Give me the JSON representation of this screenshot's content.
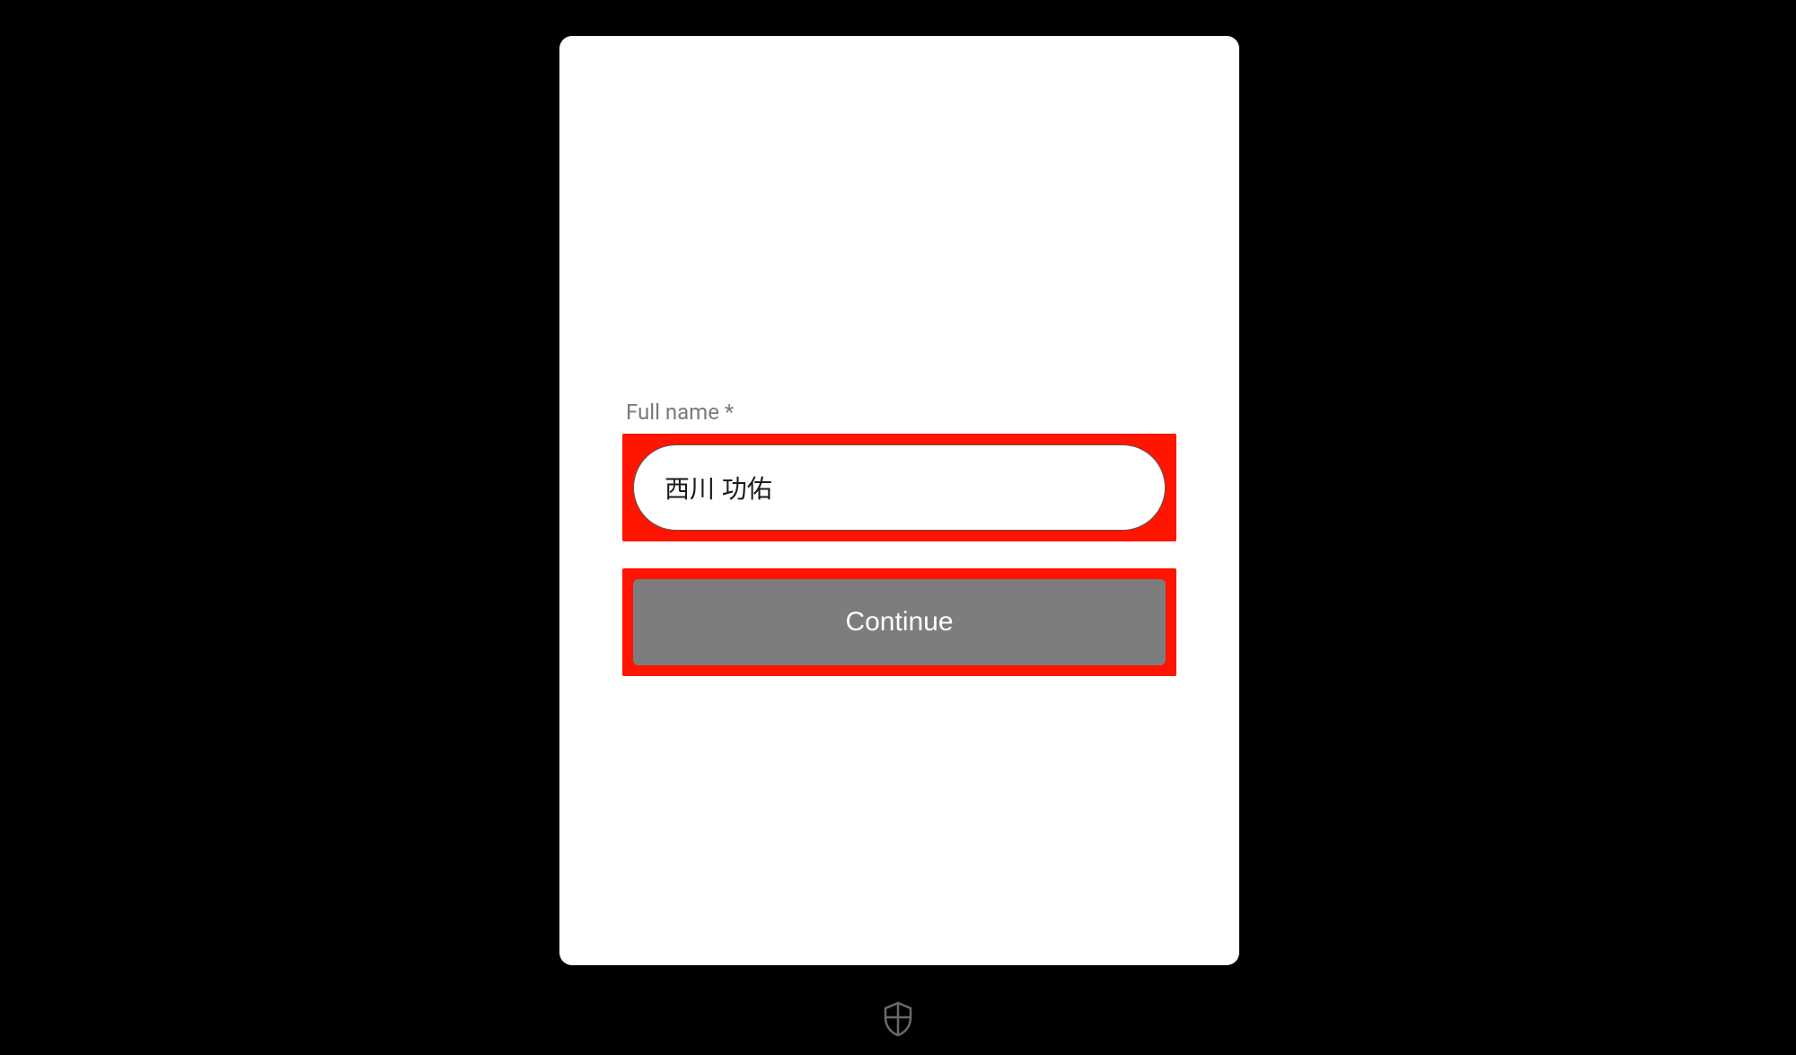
{
  "form": {
    "full_name_label": "Full name *",
    "full_name_value": "西川 功佑",
    "continue_label": "Continue"
  },
  "footer": {
    "icon_name": "shield-icon"
  },
  "colors": {
    "highlight": "#ff1500",
    "button_bg": "#7d7d7d",
    "label": "#7a7a7a"
  }
}
